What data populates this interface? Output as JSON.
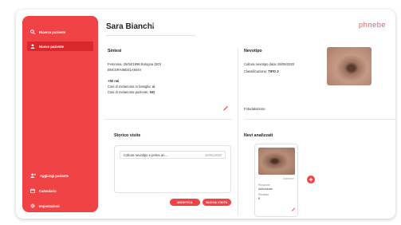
{
  "app": {
    "logo": "phnebe",
    "colors": {
      "accent": "#f04346",
      "accent_dark": "#d9282d"
    }
  },
  "sidebar": {
    "top_items": [
      {
        "label": "Ricerca paziente",
        "icon": "search-icon",
        "active": false
      },
      {
        "label": "Nuovo paziente",
        "icon": "user-icon",
        "active": true
      }
    ],
    "bottom_items": [
      {
        "label": "Aggiungi paziente",
        "icon": "add-user-icon"
      },
      {
        "label": "Calendario",
        "icon": "calendar-icon"
      },
      {
        "label": "Impostazioni",
        "icon": "gear-icon"
      }
    ]
  },
  "patient": {
    "name": "Sara Bianchi",
    "close": "×"
  },
  "sintesi": {
    "title": "Sintesi",
    "line1": "Femmina, 25/04/1996 Bologna (BO)",
    "line2": "BNCSRA96D41A944V",
    "line3": "+50 nei",
    "line4_label": "Casi di melanoma in famiglia:",
    "line4_value": "sì",
    "line5_label": "Casi di melanoma paziente:",
    "line5_value": "NO"
  },
  "nevotipo": {
    "title": "Nevotipo",
    "line1": "Cultura nevotipo data: 26/05/2020",
    "line2_label": "Classificazione:",
    "line2_value": "TIPO 3",
    "footer": "Fotodatazione"
  },
  "storico": {
    "title": "Storico visite",
    "visit_text": "Coltura nevotipo e prima an...",
    "visit_date": "26/05/2020",
    "btn_modify": "MODIFICA",
    "btn_new": "NUOVA VISITA"
  },
  "nevi": {
    "title": "Nevi analizzati",
    "card": {
      "side_label": "Anteriore",
      "field1_label": "Posizione",
      "field1_value": "Addominale",
      "field2_label": "Risultato",
      "field2_value": "B"
    },
    "add_label": "+"
  }
}
